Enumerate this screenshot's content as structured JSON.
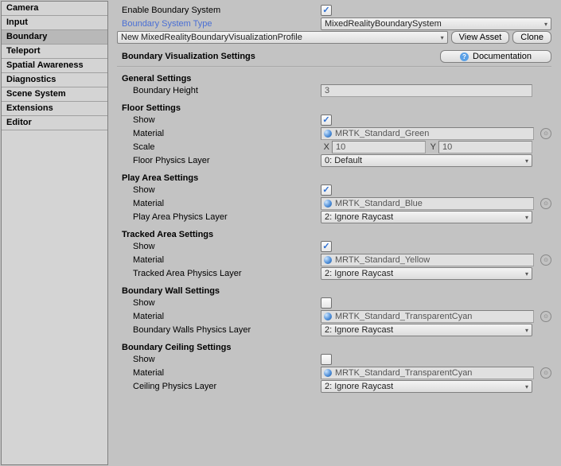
{
  "sidebar": {
    "items": [
      {
        "label": "Camera"
      },
      {
        "label": "Input"
      },
      {
        "label": "Boundary"
      },
      {
        "label": "Teleport"
      },
      {
        "label": "Spatial Awareness"
      },
      {
        "label": "Diagnostics"
      },
      {
        "label": "Scene System"
      },
      {
        "label": "Extensions"
      },
      {
        "label": "Editor"
      }
    ],
    "active_index": 2
  },
  "header": {
    "enable_label": "Enable Boundary System",
    "enable_checked": true,
    "type_label": "Boundary System Type",
    "type_value": "MixedRealityBoundarySystem",
    "profile_value": "New MixedRealityBoundaryVisualizationProfile",
    "view_asset_label": "View Asset",
    "clone_label": "Clone"
  },
  "vis": {
    "title": "Boundary Visualization Settings",
    "doc_label": "Documentation"
  },
  "general": {
    "title": "General Settings",
    "boundary_height_label": "Boundary Height",
    "boundary_height_value": "3"
  },
  "floor": {
    "title": "Floor Settings",
    "show_label": "Show",
    "show_checked": true,
    "material_label": "Material",
    "material_value": "MRTK_Standard_Green",
    "scale_label": "Scale",
    "scale_x": "10",
    "scale_y": "10",
    "layer_label": "Floor Physics Layer",
    "layer_value": "0: Default"
  },
  "playarea": {
    "title": "Play Area Settings",
    "show_label": "Show",
    "show_checked": true,
    "material_label": "Material",
    "material_value": "MRTK_Standard_Blue",
    "layer_label": "Play Area Physics Layer",
    "layer_value": "2: Ignore Raycast"
  },
  "tracked": {
    "title": "Tracked Area Settings",
    "show_label": "Show",
    "show_checked": true,
    "material_label": "Material",
    "material_value": "MRTK_Standard_Yellow",
    "layer_label": "Tracked Area Physics Layer",
    "layer_value": "2: Ignore Raycast"
  },
  "wall": {
    "title": "Boundary Wall Settings",
    "show_label": "Show",
    "show_checked": false,
    "material_label": "Material",
    "material_value": "MRTK_Standard_TransparentCyan",
    "layer_label": "Boundary Walls Physics Layer",
    "layer_value": "2: Ignore Raycast"
  },
  "ceiling": {
    "title": "Boundary Ceiling Settings",
    "show_label": "Show",
    "show_checked": false,
    "material_label": "Material",
    "material_value": "MRTK_Standard_TransparentCyan",
    "layer_label": "Ceiling Physics Layer",
    "layer_value": "2: Ignore Raycast"
  },
  "ui": {
    "x": "X",
    "y": "Y"
  }
}
